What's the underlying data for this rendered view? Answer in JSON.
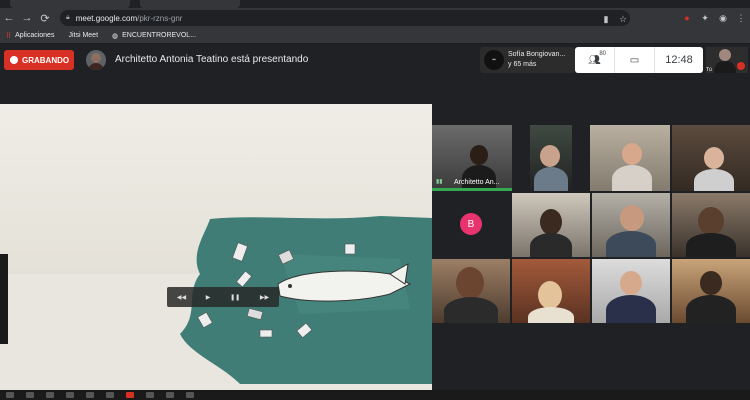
{
  "browser": {
    "url_host": "meet.google.com",
    "url_path": "/pkr-rzns-gnr",
    "bookmarks": [
      {
        "label": "Aplicaciones"
      },
      {
        "label": "Jitsi Meet"
      },
      {
        "label": "ENCUENTROREVOL..."
      }
    ]
  },
  "meet": {
    "recording_label": "GRABANDO",
    "presenting_text": "Architetto Antonia Teatino está presentando",
    "participants_box": {
      "line1": "Sofía Bongiovan...",
      "line2": "y 65 más"
    },
    "participant_count": "80",
    "clock": "12:48",
    "self_label": "Tú",
    "tiles": [
      {
        "name": "Architetto An...",
        "speaking": true
      },
      {
        "letter": "B"
      }
    ]
  },
  "colors": {
    "record_red": "#d93025",
    "speaking_green": "#34a853",
    "avatar_pink": "#e8336f",
    "background": "#202124"
  }
}
